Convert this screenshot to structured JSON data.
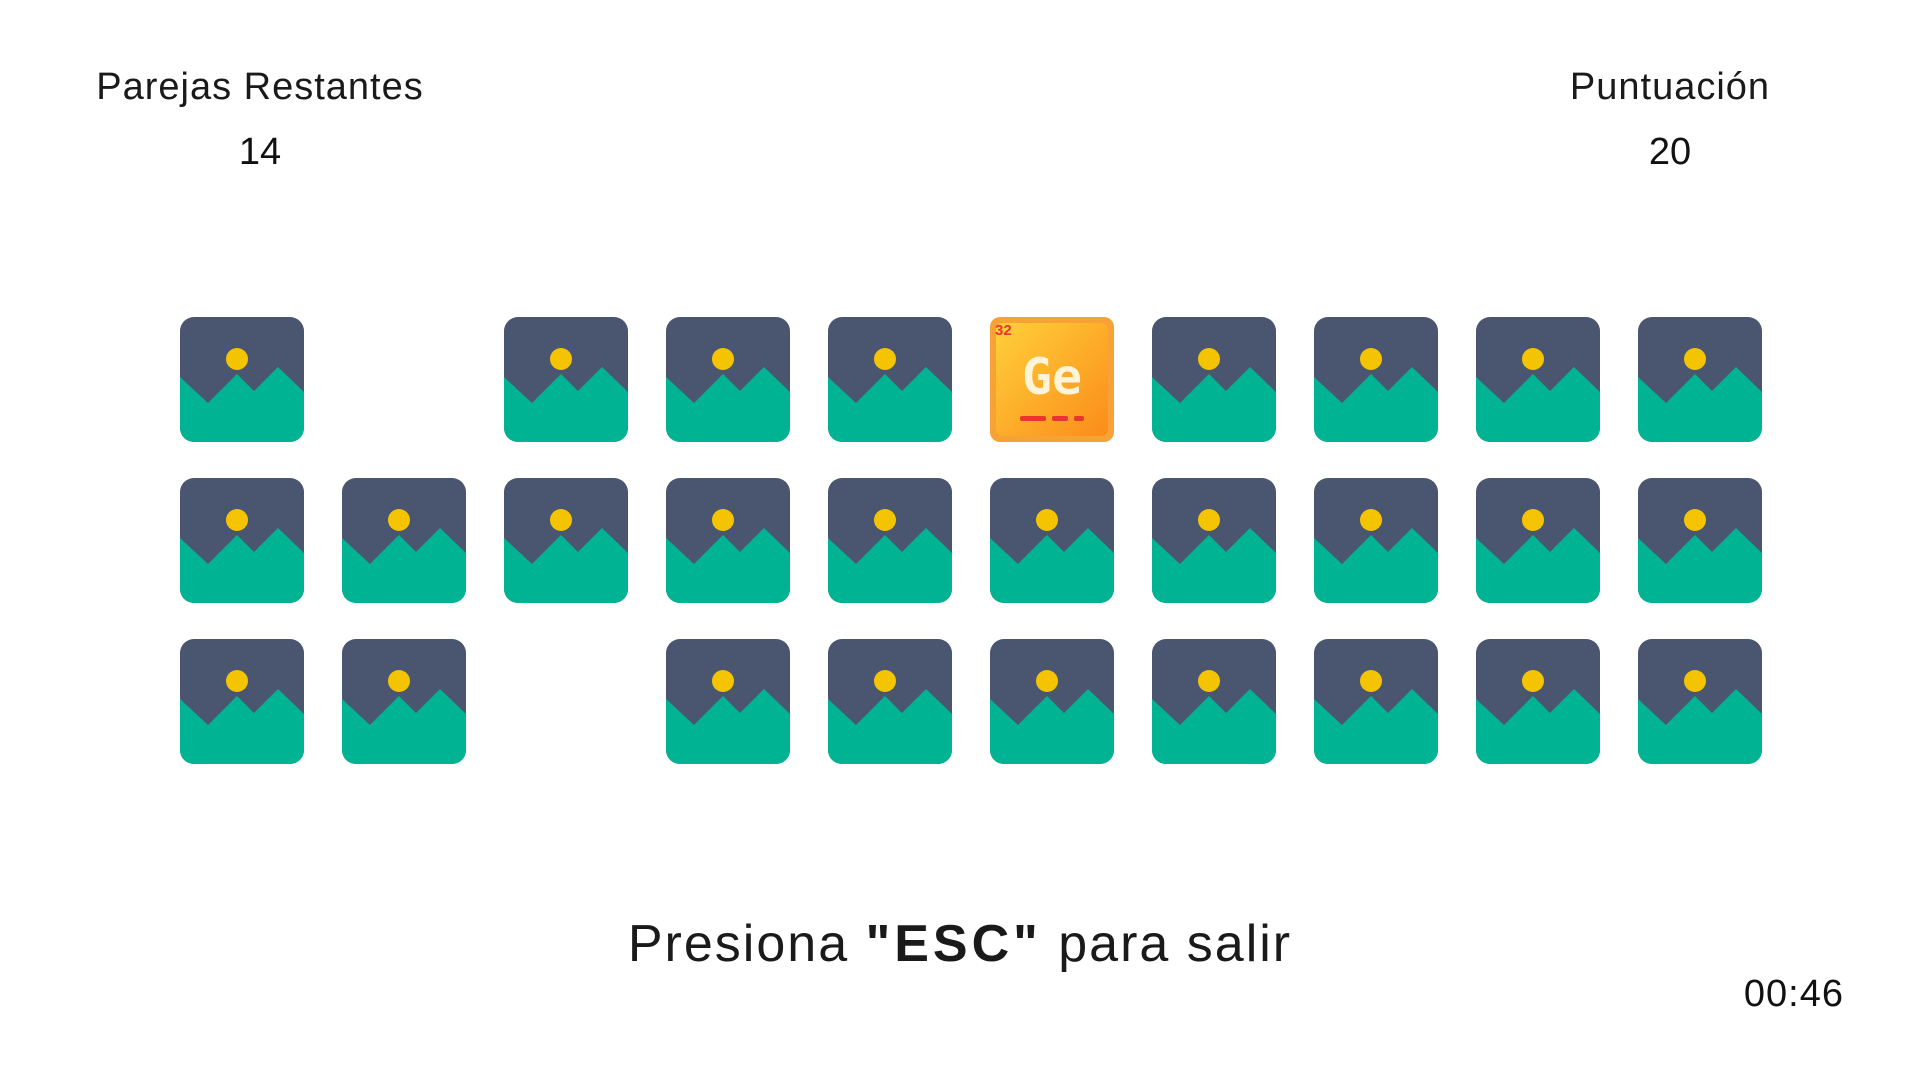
{
  "stats": {
    "pairs_label": "Parejas Restantes",
    "pairs_value": "14",
    "score_label": "Puntuación",
    "score_value": "20"
  },
  "board": {
    "rows": [
      [
        "hidden",
        "empty",
        "hidden",
        "hidden",
        "hidden",
        "element",
        "hidden",
        "hidden",
        "hidden",
        "hidden"
      ],
      [
        "hidden",
        "hidden",
        "hidden",
        "hidden",
        "hidden",
        "hidden",
        "hidden",
        "hidden",
        "hidden",
        "hidden"
      ],
      [
        "hidden",
        "hidden",
        "empty",
        "hidden",
        "hidden",
        "hidden",
        "hidden",
        "hidden",
        "hidden",
        "hidden"
      ]
    ],
    "revealed_card": {
      "atomic_number": "32",
      "symbol": "Ge"
    },
    "hidden_card_icon": "image-placeholder-icon"
  },
  "instructions": {
    "before": "Presiona ",
    "key": "\"ESC\"",
    "after": " para salir"
  },
  "timer": "00:46",
  "colors": {
    "card_sky": "#4a5670",
    "card_ground": "#00b493",
    "card_sun": "#f5c400",
    "element_bg": "#fb8c1a",
    "element_accent": "#e8352e"
  }
}
